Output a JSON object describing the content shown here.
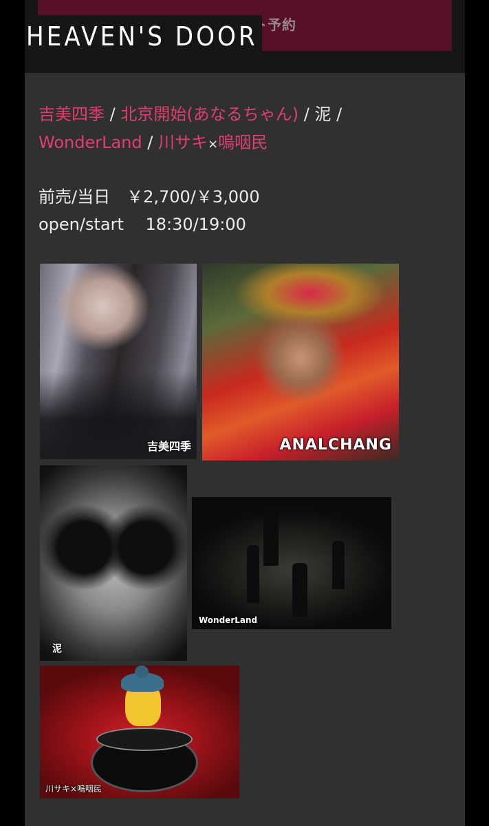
{
  "header": {
    "logo_text": "HEAVEN'S DOOR",
    "ticket_label": "チケット予約"
  },
  "lineup": [
    {
      "name": "吉美四季",
      "linked": true
    },
    {
      "name": "北京開始(あなるちゃん)",
      "linked": true
    },
    {
      "name": "泥",
      "linked": false
    },
    {
      "name": "WonderLand",
      "linked": true
    },
    {
      "name": "川サキ",
      "linked": true
    },
    {
      "name": "嗚咽民",
      "linked": true
    }
  ],
  "separators": {
    "slash": "/",
    "times": "×"
  },
  "info": {
    "price_line": "前売/当日　￥2,700/￥3,000",
    "time_line": "open/start　 18:30/19:00"
  },
  "photos": [
    {
      "caption": "吉美四季"
    },
    {
      "caption": "ANALCHANG"
    },
    {
      "caption": "泥"
    },
    {
      "caption": "WonderLand"
    },
    {
      "caption": "川サキ×嗚咽民"
    }
  ],
  "colors": {
    "accent": "#e13e6f",
    "ticket_bg": "#561029",
    "content_bg": "#303030",
    "header_bg": "#161616"
  }
}
